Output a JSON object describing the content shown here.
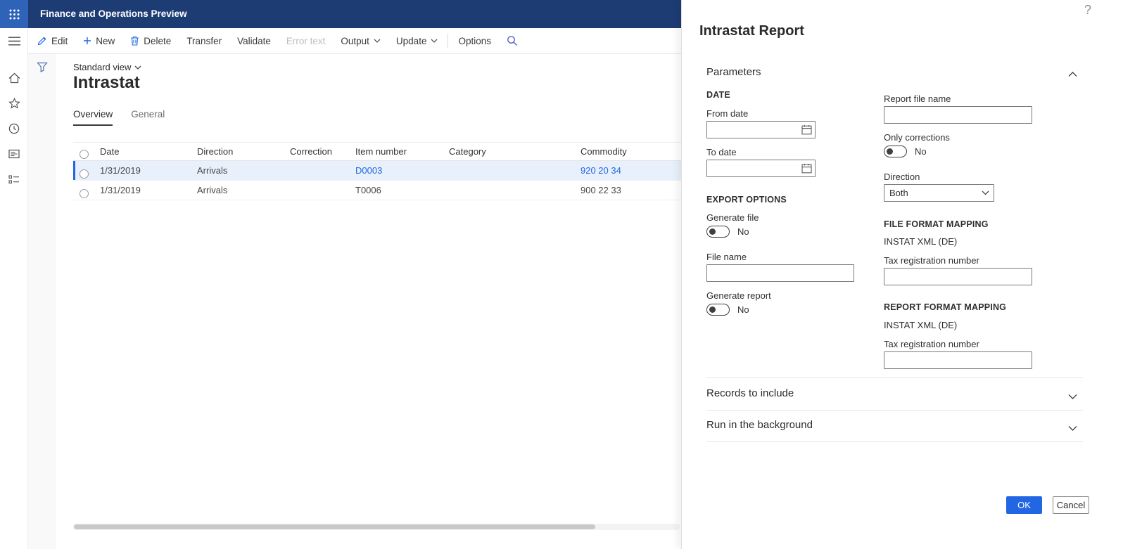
{
  "colors": {
    "accent": "#2266E3",
    "header_bg": "#1d3c74",
    "waffle_bg": "#2e63b8",
    "selected_row_bg": "#e7f0fb",
    "disabled_text": "#bdbdbd"
  },
  "header": {
    "app_title": "Finance and Operations Preview",
    "help_icon": "?"
  },
  "toolbar": {
    "items": [
      {
        "label": "Edit"
      },
      {
        "label": "New"
      },
      {
        "label": "Delete"
      },
      {
        "label": "Transfer"
      },
      {
        "label": "Validate"
      },
      {
        "label": "Error text",
        "disabled": true
      },
      {
        "label": "Output",
        "dropdown": true
      },
      {
        "label": "Update",
        "dropdown": true
      },
      {
        "label": "Options"
      }
    ]
  },
  "page": {
    "view_selector": "Standard view",
    "title": "Intrastat",
    "tabs": [
      {
        "label": "Overview",
        "active": true
      },
      {
        "label": "General",
        "active": false
      }
    ]
  },
  "grid": {
    "columns": [
      "Date",
      "Direction",
      "Correction",
      "Item number",
      "Category",
      "Commodity"
    ],
    "rows": [
      {
        "date": "1/31/2019",
        "direction": "Arrivals",
        "correction": "",
        "item_number": "D0003",
        "category": "",
        "commodity": "920 20 34",
        "selected": true
      },
      {
        "date": "1/31/2019",
        "direction": "Arrivals",
        "correction": "",
        "item_number": "T0006",
        "category": "",
        "commodity": "900 22 33",
        "selected": false
      }
    ]
  },
  "dialog": {
    "title": "Intrastat Report",
    "sections": {
      "parameters": {
        "label": "Parameters",
        "expanded": true
      },
      "records_to_include": {
        "label": "Records to include",
        "expanded": false
      },
      "run_in_background": {
        "label": "Run in the background",
        "expanded": false
      }
    },
    "date_group": {
      "label": "DATE",
      "from_date_label": "From date",
      "from_date_value": "",
      "to_date_label": "To date",
      "to_date_value": ""
    },
    "export_options": {
      "label": "EXPORT OPTIONS",
      "generate_file_label": "Generate file",
      "generate_file_value": "No",
      "file_name_label": "File name",
      "file_name_value": "",
      "generate_report_label": "Generate report",
      "generate_report_value": "No"
    },
    "report_options": {
      "report_file_name_label": "Report file name",
      "report_file_name_value": "",
      "only_corrections_label": "Only corrections",
      "only_corrections_value": "No",
      "direction_label": "Direction",
      "direction_value": "Both"
    },
    "file_format_mapping": {
      "label": "FILE FORMAT MAPPING",
      "format_name": "INSTAT XML (DE)",
      "tax_registration_label": "Tax registration number",
      "tax_registration_value": ""
    },
    "report_format_mapping": {
      "label": "REPORT FORMAT MAPPING",
      "format_name": "INSTAT XML (DE)",
      "tax_registration_label": "Tax registration number",
      "tax_registration_value": ""
    },
    "footer": {
      "ok_label": "OK",
      "cancel_label": "Cancel"
    }
  }
}
